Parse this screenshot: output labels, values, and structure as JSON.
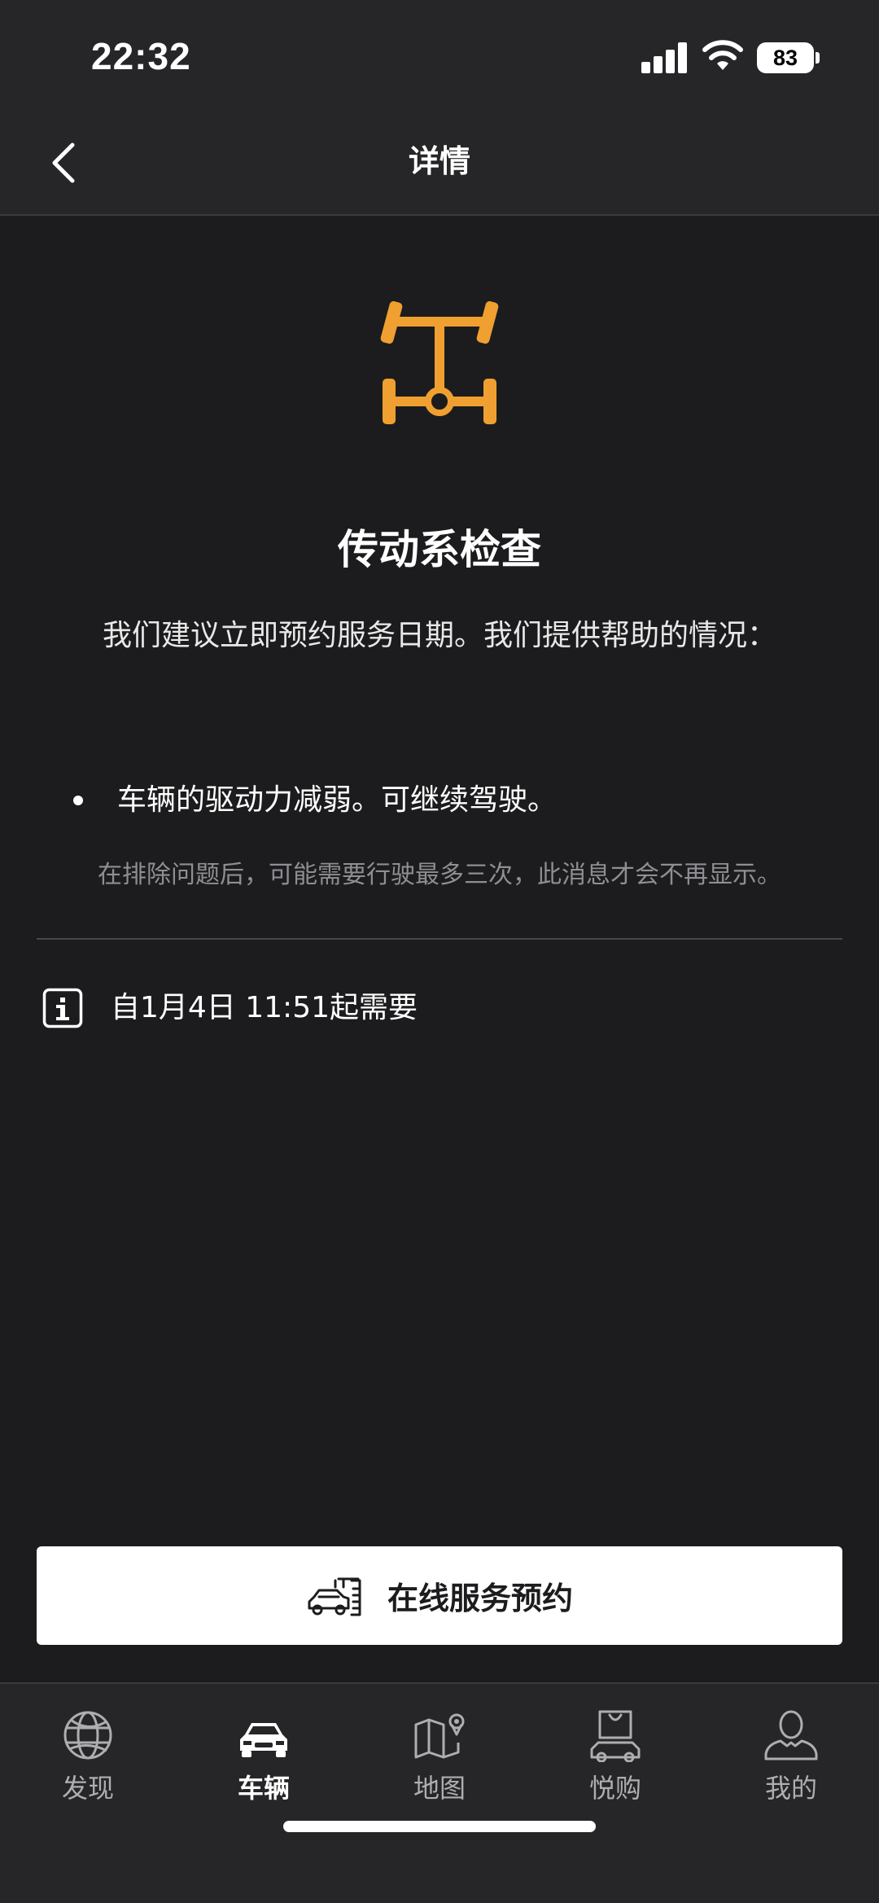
{
  "status_bar": {
    "time": "22:32",
    "battery": "83"
  },
  "header": {
    "title": "详情",
    "back_icon": "chevron-left-icon"
  },
  "alert": {
    "icon": "drivetrain-icon",
    "icon_color": "#f0a030",
    "title": "传动系检查",
    "description": "我们建议立即预约服务日期。我们提供帮助的情况：",
    "bullets": [
      "车辆的驱动力减弱。可继续驾驶。"
    ],
    "note": "在排除问题后，可能需要行驶最多三次，此消息才会不再显示。",
    "info_icon": "info-icon",
    "info_text": "自1月4日 11:51起需要"
  },
  "cta": {
    "icon": "car-service-icon",
    "label": "在线服务预约"
  },
  "tabbar": {
    "items": [
      {
        "label": "发现",
        "icon": "globe-icon",
        "active": false
      },
      {
        "label": "车辆",
        "icon": "car-icon",
        "active": true
      },
      {
        "label": "地图",
        "icon": "map-icon",
        "active": false
      },
      {
        "label": "悦购",
        "icon": "shopping-bag-icon",
        "active": false
      },
      {
        "label": "我的",
        "icon": "user-icon",
        "active": false
      }
    ]
  }
}
